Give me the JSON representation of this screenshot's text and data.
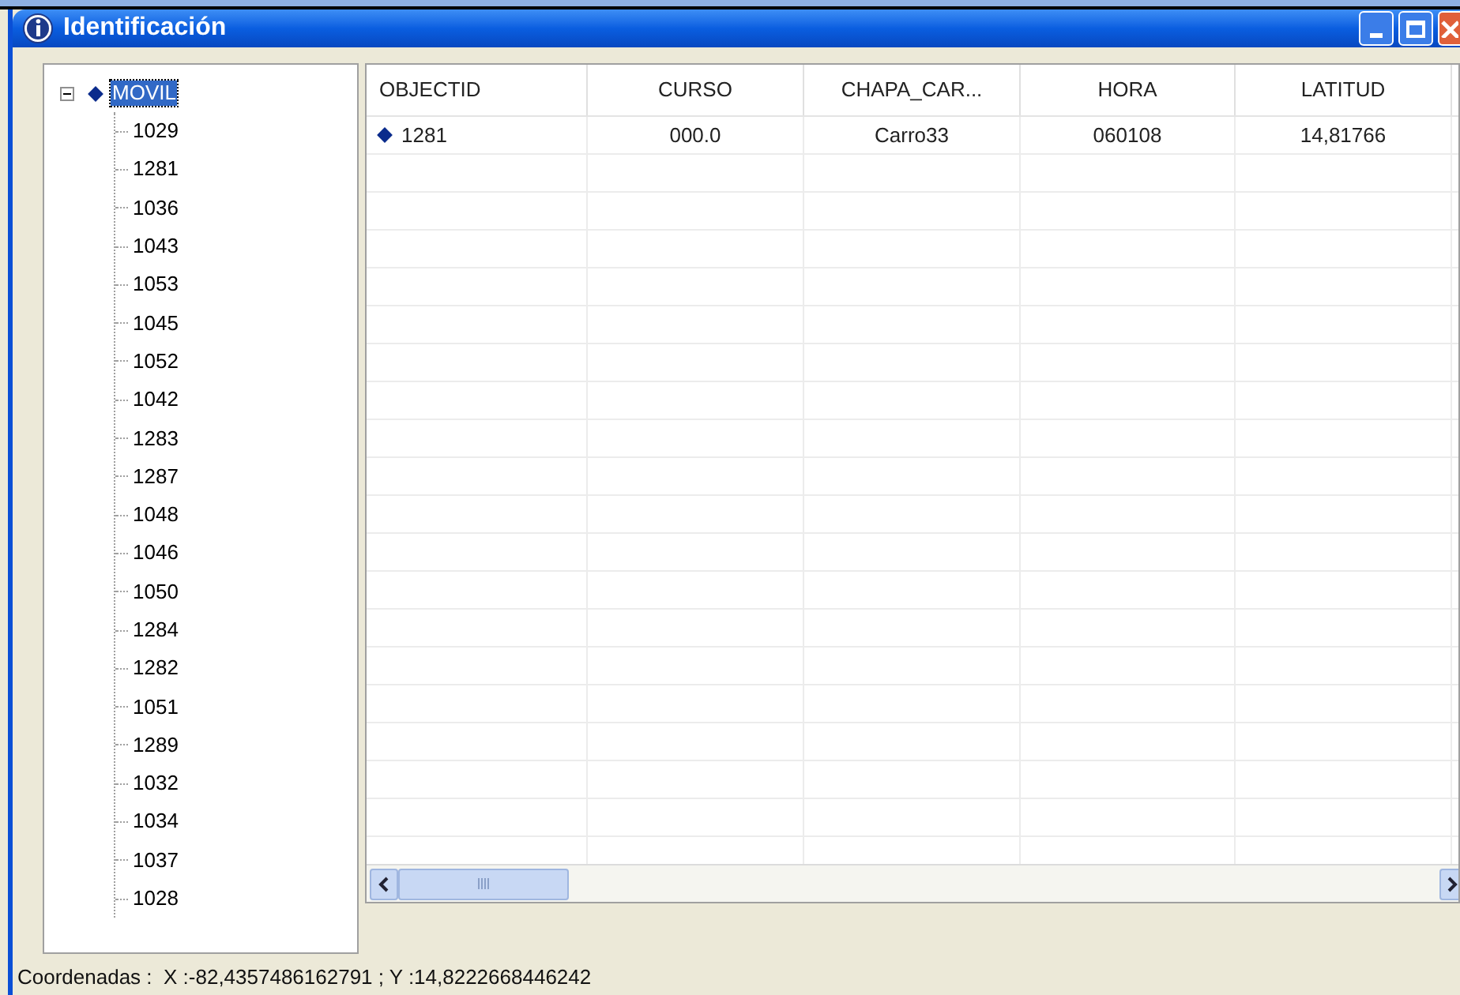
{
  "window": {
    "title": "Identificación"
  },
  "tree": {
    "root": {
      "label": "MOVIL",
      "expanded": true,
      "selected": true,
      "children": [
        {
          "label": "1029"
        },
        {
          "label": "1281"
        },
        {
          "label": "1036"
        },
        {
          "label": "1043"
        },
        {
          "label": "1053"
        },
        {
          "label": "1045"
        },
        {
          "label": "1052"
        },
        {
          "label": "1042"
        },
        {
          "label": "1283"
        },
        {
          "label": "1287"
        },
        {
          "label": "1048"
        },
        {
          "label": "1046"
        },
        {
          "label": "1050"
        },
        {
          "label": "1284"
        },
        {
          "label": "1282"
        },
        {
          "label": "1051"
        },
        {
          "label": "1289"
        },
        {
          "label": "1032"
        },
        {
          "label": "1034"
        },
        {
          "label": "1037"
        },
        {
          "label": "1028"
        }
      ]
    }
  },
  "table": {
    "columns": [
      {
        "label": "OBJECTID"
      },
      {
        "label": "CURSO"
      },
      {
        "label": "CHAPA_CAR..."
      },
      {
        "label": "HORA"
      },
      {
        "label": "LATITUD"
      }
    ],
    "rows": [
      {
        "cells": [
          "1281",
          "000.0",
          "Carro33",
          "060108",
          "14,81766"
        ]
      }
    ]
  },
  "status_bar": "Coordenadas :  X :-82,4357486162791 ; Y :14,8222668446242"
}
